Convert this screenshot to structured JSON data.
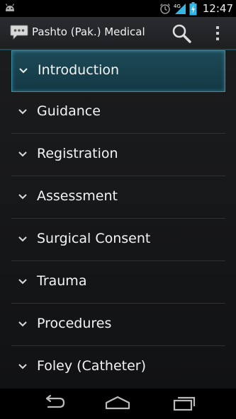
{
  "status_bar": {
    "time": "12:47",
    "network": "4G",
    "icons": [
      "android-icon",
      "alarm-icon",
      "signal-icon",
      "battery-charging-icon"
    ]
  },
  "action_bar": {
    "title": "Pashto (Pak.) Medical",
    "icons": [
      "app-speech-bubble-icon",
      "search-icon",
      "overflow-menu-icon"
    ]
  },
  "list": {
    "items": [
      {
        "label": "Introduction",
        "selected": true
      },
      {
        "label": "Guidance"
      },
      {
        "label": "Registration"
      },
      {
        "label": "Assessment"
      },
      {
        "label": "Surgical Consent"
      },
      {
        "label": "Trauma"
      },
      {
        "label": "Procedures"
      },
      {
        "label": "Foley (Catheter)"
      }
    ]
  },
  "nav_bar": {
    "icons": [
      "back-icon",
      "home-icon",
      "recent-apps-icon"
    ]
  },
  "colors": {
    "accent": "#33b5e5",
    "selected_bg": "#1d4a57",
    "background": "#111214"
  }
}
